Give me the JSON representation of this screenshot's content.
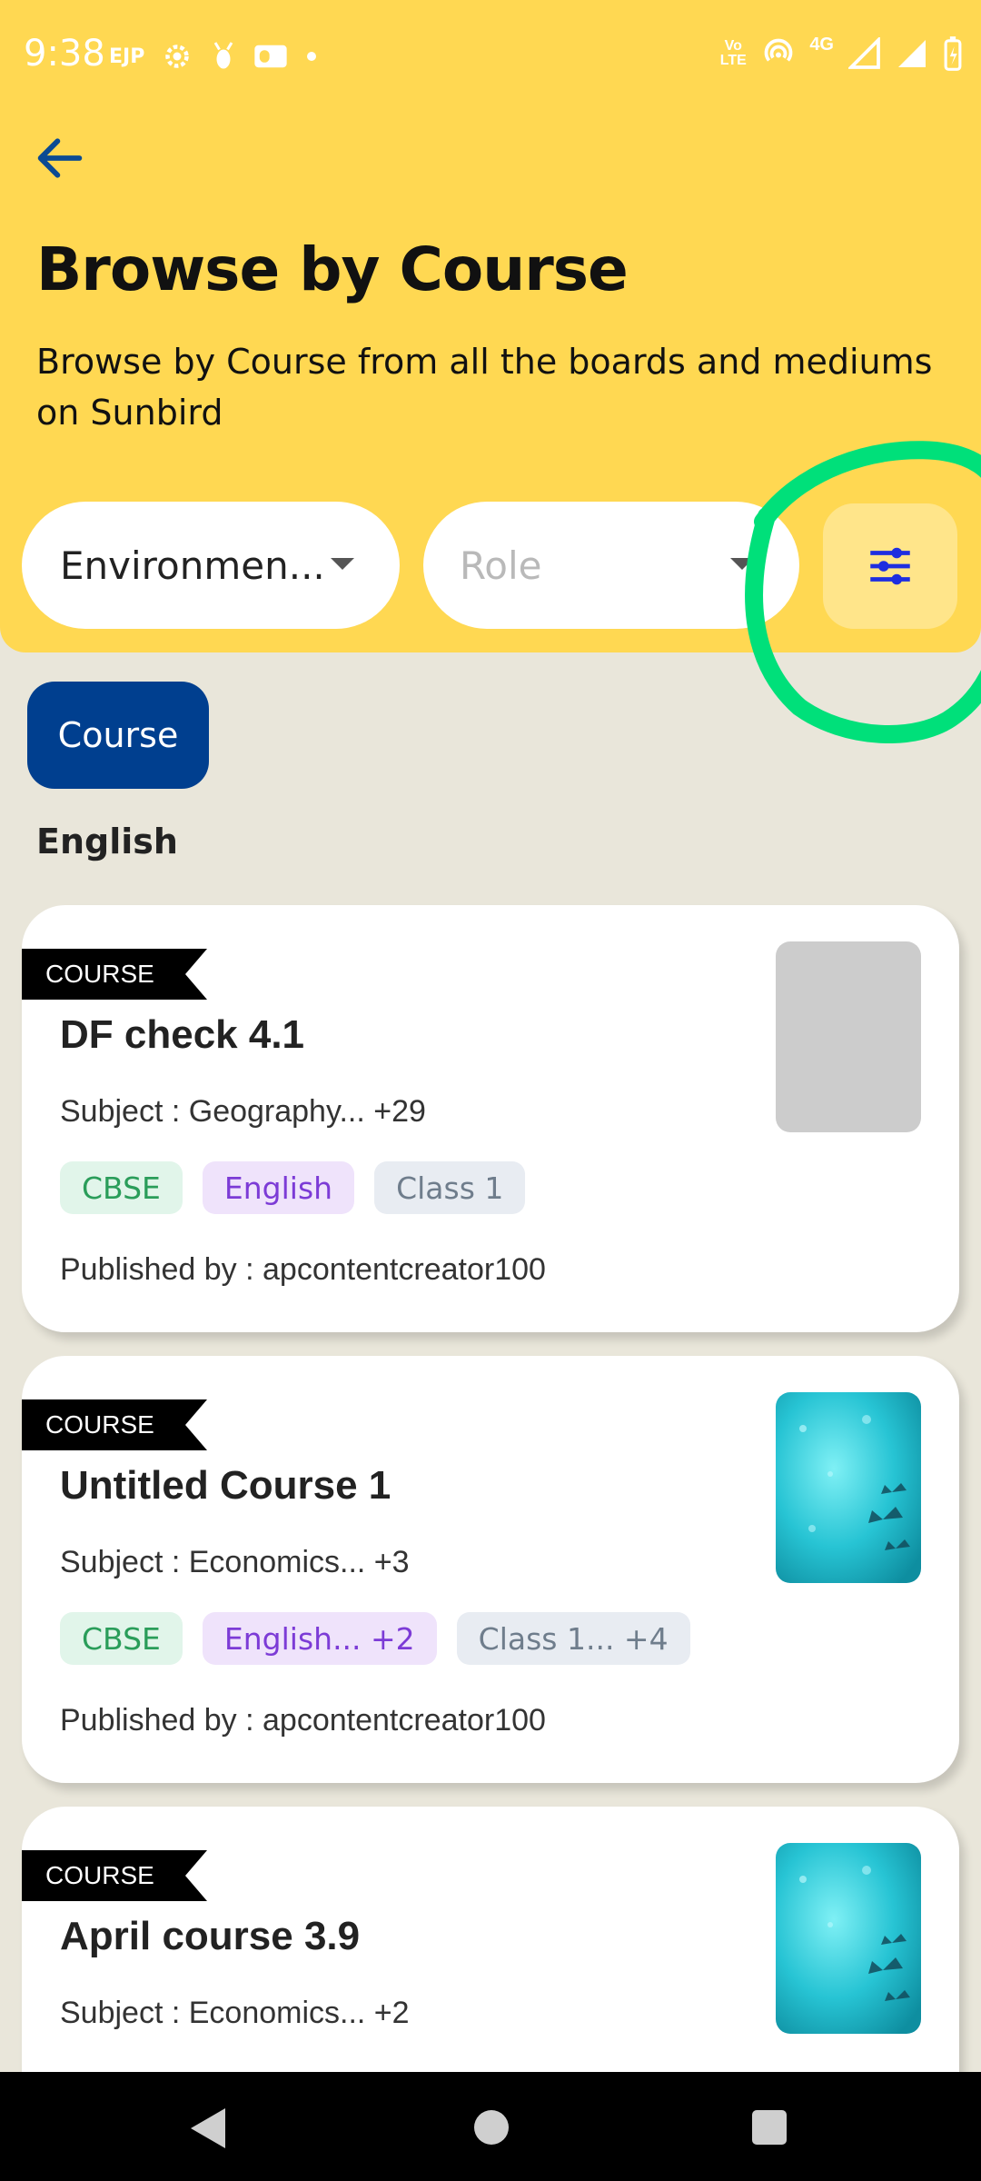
{
  "status_bar": {
    "time": "9:38",
    "carrier_badge": "EJP",
    "network": "4G",
    "volte": "Vo LTE"
  },
  "header": {
    "title": "Browse by Course",
    "subtitle": "Browse by Course from all the boards and mediums on Sunbird"
  },
  "filters": {
    "subject_value": "Environmen...",
    "role_placeholder": "Role"
  },
  "content_type_chip": "Course",
  "section_title": "English",
  "cards": [
    {
      "tag": "COURSE",
      "title": "DF check 4.1",
      "subject": "Subject : Geography... +29",
      "board": "CBSE",
      "medium": "English",
      "grade": "Class 1",
      "publisher": "Published by : apcontentcreator100",
      "thumbnail": "placeholder"
    },
    {
      "tag": "COURSE",
      "title": "Untitled Course 1",
      "subject": "Subject : Economics... +3",
      "board": "CBSE",
      "medium": "English... +2",
      "grade": "Class 1... +4",
      "publisher": "Published by : apcontentcreator100",
      "thumbnail": "butterfly"
    },
    {
      "tag": "COURSE",
      "title": "April course 3.9",
      "subject": "Subject : Economics... +2",
      "thumbnail": "butterfly"
    }
  ],
  "colors": {
    "header_bg": "#ffd852",
    "page_bg": "#e9e6da",
    "chip_active": "#003f8f",
    "highlight": "#00e07a"
  }
}
